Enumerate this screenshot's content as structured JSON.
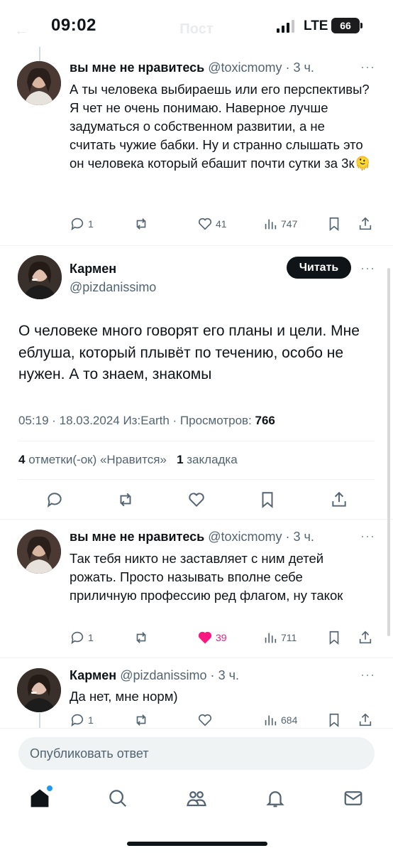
{
  "status_bar": {
    "time": "09:02",
    "network": "LTE",
    "battery": "66",
    "header_title": "Пост"
  },
  "tweets": [
    {
      "name": "вы мне не нравитесь",
      "handle": "@toxicmomy",
      "time": "3 ч.",
      "text": "А ты человека выбираешь или его перспективы? Я чет не очень понимаю. Наверное лучше задуматься о собственном развитии, а не считать чужие бабки. Ну и странно слышать это он человека который ебашит почти сутки за 3к🫠",
      "replies": "1",
      "retweets": "",
      "likes": "41",
      "views": "747"
    },
    {
      "name": "вы мне не нравитесь",
      "handle": "@toxicmomy",
      "time": "3 ч.",
      "text": "Так тебя никто не заставляет с ним детей рожать. Просто называть вполне себе приличную профессию ред флагом, ну такок",
      "replies": "1",
      "retweets": "",
      "likes": "39",
      "views": "711"
    },
    {
      "name": "Кармен",
      "handle": "@pizdanissimo",
      "time": "3 ч.",
      "text": "Да нет, мне норм)",
      "replies": "1",
      "retweets": "",
      "likes": "",
      "views": "684"
    }
  ],
  "main_post": {
    "name": "Кармен",
    "handle": "@pizdanissimo",
    "follow_label": "Читать",
    "text": "О человеке много говорят его планы и цели. Мне еблуша, который плывёт по течению, особо не нужен. А то знаем, знакомы",
    "timestamp": "05:19 · 18.03.2024 Из:Earth · Просмотров: ",
    "views": "766",
    "likes_count": "4",
    "likes_label": "отметки(-ок) «Нравится»",
    "bookmarks_count": "1",
    "bookmarks_label": "закладка"
  },
  "reply_box": {
    "placeholder": "Опубликовать ответ"
  },
  "icons": {
    "tabs": [
      "home-icon",
      "search-icon",
      "communities-icon",
      "notifications-icon",
      "messages-icon"
    ]
  },
  "colors": {
    "text": "#0f1419",
    "secondary": "#536471",
    "like": "#f91880",
    "accent": "#1d9bf0"
  }
}
